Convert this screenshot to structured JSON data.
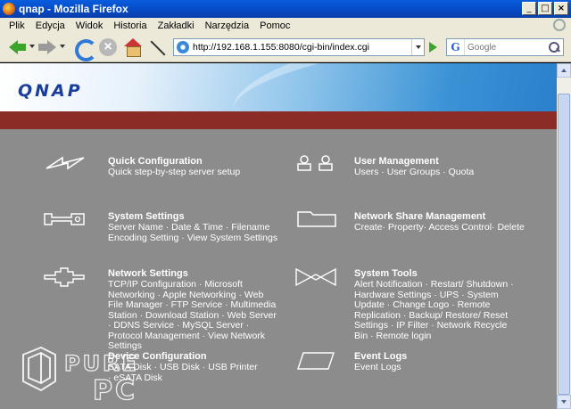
{
  "window": {
    "title": "qnap - Mozilla Firefox",
    "buttons": [
      "_",
      "□",
      "×"
    ]
  },
  "menu": [
    "Plik",
    "Edycja",
    "Widok",
    "Historia",
    "Zakładki",
    "Narzędzia",
    "Pomoc"
  ],
  "toolbar": {
    "url": "http://192.168.1.155:8080/cgi-bin/index.cgi",
    "search_engine": "G",
    "search_placeholder": "Google"
  },
  "page": {
    "logo": "QNAP",
    "items": [
      {
        "title": "Quick Configuration",
        "sub": "Quick step-by-step server setup"
      },
      {
        "title": "User Management",
        "sub": "Users · User Groups · Quota"
      },
      {
        "title": "System Settings",
        "sub": "Server Name · Date & Time · Filename Encoding Setting · View System Settings"
      },
      {
        "title": "Network Share Management",
        "sub": "Create· Property· Access Control· Delete"
      },
      {
        "title": "Network Settings",
        "sub": "TCP/IP Configuration · Microsoft Networking · Apple Networking · Web File Manager · FTP Service · Multimedia Station · Download Station · Web Server · DDNS Service · MySQL Server · Protocol Management · View Network Settings"
      },
      {
        "title": "System Tools",
        "sub": "Alert Notification · Restart/ Shutdown · Hardware Settings · UPS · System Update · Change Logo · Remote Replication · Backup/ Restore/ Reset Settings · IP Filter · Network Recycle Bin · Remote login"
      },
      {
        "title": "Device Configuration",
        "sub": "SATA Disk · USB Disk · USB Printer · eSATA Disk"
      },
      {
        "title": "Event Logs",
        "sub": "Event Logs"
      }
    ]
  },
  "watermark": {
    "line1": "PURE",
    "line2": "PC"
  },
  "colors": {
    "banner_red": "#8b2c26",
    "content_gray": "#8c8c8c",
    "logo_blue": "#1a3f9a"
  }
}
